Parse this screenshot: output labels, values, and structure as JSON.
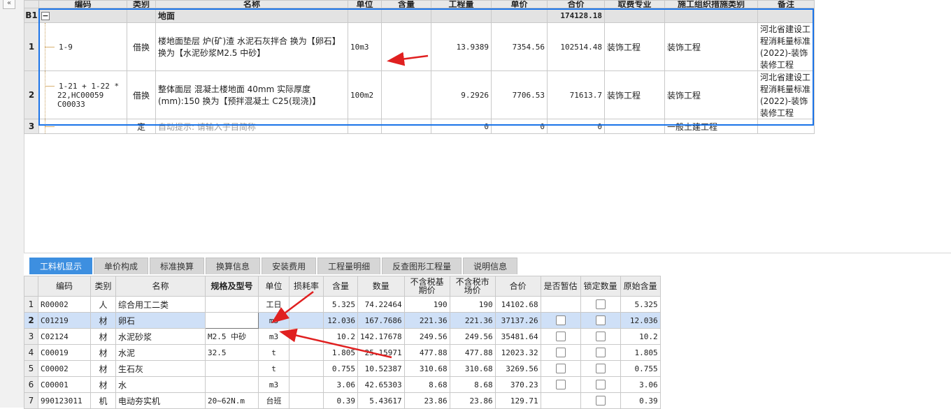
{
  "sidebar": {
    "collapse_label": "«"
  },
  "top_table": {
    "headers": [
      "",
      "编码",
      "类别",
      "名称",
      "单位",
      "含量",
      "工程量",
      "单价",
      "合价",
      "取费专业",
      "施工组织措施类别",
      "备注"
    ],
    "group_row": {
      "id": "B1",
      "toggle": "−",
      "name": "地面",
      "total": "174128.18"
    },
    "rows": [
      {
        "rn": "1",
        "code": "1-9",
        "type": "借换",
        "name": "楼地面垫层 炉(矿)渣 水泥石灰拌合  换为【卵石】 换为【水泥砂浆M2.5 中砂】",
        "unit": "10m3",
        "content": "",
        "qty": "13.9389",
        "price": "7354.56",
        "total": "102514.48",
        "fee": "装饰工程",
        "measure": "装饰工程",
        "remark": "河北省建设工程消耗量标准(2022)-装饰装修工程"
      },
      {
        "rn": "2",
        "code": "1-21 + 1-22 * 22,HC00059 C00033",
        "type": "借换",
        "name": "整体面层 混凝土楼地面 40mm  实际厚度(mm):150  换为【预拌混凝土 C25(现浇)】",
        "unit": "100m2",
        "content": "",
        "qty": "9.2926",
        "price": "7706.53",
        "total": "71613.7",
        "fee": "装饰工程",
        "measure": "装饰工程",
        "remark": "河北省建设工程消耗量标准(2022)-装饰装修工程"
      },
      {
        "rn": "3",
        "code": "",
        "type": "定",
        "name": "自动提示: 请输入子目简称",
        "unit": "",
        "content": "",
        "qty": "0",
        "price": "0",
        "total": "0",
        "fee": "",
        "measure": "一般土建工程",
        "remark": ""
      }
    ]
  },
  "tabs": [
    "工料机显示",
    "单价构成",
    "标准换算",
    "换算信息",
    "安装费用",
    "工程量明细",
    "反查图形工程量",
    "说明信息"
  ],
  "bottom_table": {
    "headers": [
      "",
      "编码",
      "类别",
      "名称",
      "规格及型号",
      "单位",
      "损耗率",
      "含量",
      "数量",
      "不含税基期价",
      "不含税市场价",
      "合价",
      "是否暂估",
      "锁定数量",
      "原始含量"
    ],
    "rows": [
      {
        "rn": "1",
        "code": "R00002",
        "type": "人",
        "name": "综合用工二类",
        "spec": "",
        "unit": "工日",
        "loss": "",
        "content": "5.325",
        "qty": "74.22464",
        "base": "190",
        "market": "190",
        "total": "14102.68",
        "temp": false,
        "lock": true,
        "orig": "5.325"
      },
      {
        "rn": "2",
        "code": "C01219",
        "type": "材",
        "name": "卵石",
        "spec": "",
        "unit": "m3",
        "loss": "",
        "content": "12.036",
        "qty": "167.7686",
        "base": "221.36",
        "market": "221.36",
        "total": "37137.26",
        "temp": true,
        "lock": true,
        "orig": "12.036"
      },
      {
        "rn": "3",
        "code": "C02124",
        "type": "材",
        "name": "水泥砂浆",
        "spec": "M2.5 中砂",
        "unit": "m3",
        "loss": "",
        "content": "10.2",
        "qty": "142.17678",
        "base": "249.56",
        "market": "249.56",
        "total": "35481.64",
        "temp": true,
        "lock": true,
        "orig": "10.2"
      },
      {
        "rn": "4",
        "code": "C00019",
        "type": "材",
        "name": "水泥",
        "spec": "32.5",
        "unit": "t",
        "loss": "",
        "content": "1.805",
        "qty": "25.15971",
        "base": "477.88",
        "market": "477.88",
        "total": "12023.32",
        "temp": true,
        "lock": true,
        "orig": "1.805"
      },
      {
        "rn": "5",
        "code": "C00002",
        "type": "材",
        "name": "生石灰",
        "spec": "",
        "unit": "t",
        "loss": "",
        "content": "0.755",
        "qty": "10.52387",
        "base": "310.68",
        "market": "310.68",
        "total": "3269.56",
        "temp": true,
        "lock": true,
        "orig": "0.755"
      },
      {
        "rn": "6",
        "code": "C00001",
        "type": "材",
        "name": "水",
        "spec": "",
        "unit": "m3",
        "loss": "",
        "content": "3.06",
        "qty": "42.65303",
        "base": "8.68",
        "market": "8.68",
        "total": "370.23",
        "temp": true,
        "lock": true,
        "orig": "3.06"
      },
      {
        "rn": "7",
        "code": "990123011",
        "type": "机",
        "name": "电动夯实机",
        "spec": "20~62N.m",
        "unit": "台班",
        "loss": "",
        "content": "0.39",
        "qty": "5.43617",
        "base": "23.86",
        "market": "23.86",
        "total": "129.71",
        "temp": false,
        "lock": true,
        "orig": "0.39"
      }
    ]
  },
  "colors": {
    "accent": "#1a73e8",
    "arrow": "#e02020",
    "tab_active": "#3d8fe0",
    "row_selected": "#cfe0f7"
  }
}
